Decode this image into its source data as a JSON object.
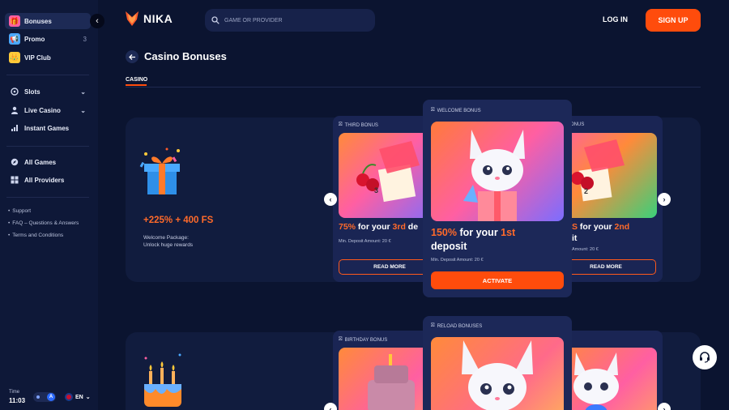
{
  "sidebar": {
    "items": [
      {
        "label": "Bonuses",
        "icon": "gift-icon"
      },
      {
        "label": "Promo",
        "icon": "megaphone-icon",
        "badge": "3"
      },
      {
        "label": "VIP Club",
        "icon": "crown-icon"
      },
      {
        "label": "Slots",
        "icon": "slot-icon"
      },
      {
        "label": "Live Casino",
        "icon": "dealer-icon"
      },
      {
        "label": "Instant Games",
        "icon": "chart-icon"
      },
      {
        "label": "All Games",
        "icon": "compass-icon"
      },
      {
        "label": "All Providers",
        "icon": "grid-icon"
      }
    ],
    "links": [
      "Support",
      "FAQ – Questions & Answers",
      "Terms and Conditions"
    ],
    "time_label": "Time",
    "time_value": "11:03",
    "toggle_letter": "A",
    "language": "EN"
  },
  "header": {
    "logo_text": "NIKA",
    "search_placeholder": "GAME OR PROVIDER",
    "login": "LOG IN",
    "signup": "SIGN UP"
  },
  "page": {
    "title": "Casino Bonuses",
    "tab": "CASINO"
  },
  "package1": {
    "title": "+225% + 400 FS",
    "sub_line1": "Welcome Package:",
    "sub_line2": "Unlock huge rewards",
    "left_card": {
      "label": "THIRD BONUS",
      "pct": "75%",
      "mid": " for your ",
      "ord": "3rd",
      "tail": " de",
      "min": "Min. Deposit Amount: 20 €",
      "button": "READ MORE",
      "box_num": "3"
    },
    "center_card": {
      "label": "WELCOME BONUS",
      "pct": "150%",
      "mid": " for your ",
      "ord": "1st",
      "line2": "deposit",
      "min": "Min. Deposit Amount: 20 €",
      "button": "ACTIVATE"
    },
    "right_card": {
      "label": "ONUS",
      "pct": "S",
      "mid": " for your ",
      "ord": "2nd",
      "line2": "it",
      "min": "Amount: 20 €",
      "button": "READ MORE",
      "box_num": "2"
    }
  },
  "package2": {
    "left_card": {
      "label": "BIRTHDAY BONUS"
    },
    "center_card": {
      "label": "RELOAD BONUSES"
    }
  },
  "colors": {
    "accent": "#ff4c0c",
    "bg": "#0b1430",
    "panel": "#111c3e",
    "card": "#1a2554"
  }
}
